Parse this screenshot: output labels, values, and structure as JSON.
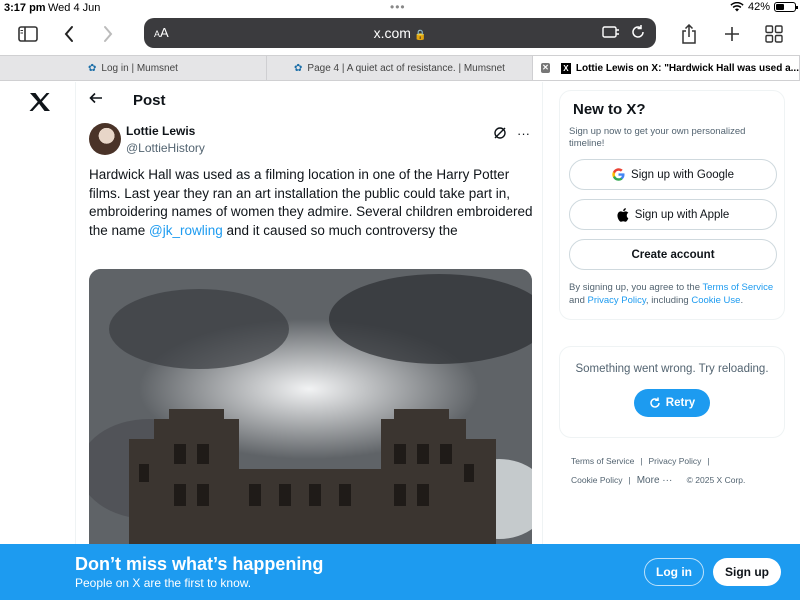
{
  "status": {
    "time": "3:17 pm",
    "date": "Wed 4 Jun",
    "battery": "42%",
    "battery_level": 0.42
  },
  "browser": {
    "text_size": "AA",
    "url": "x.com",
    "tabs": [
      {
        "label": "Log in | Mumsnet"
      },
      {
        "label": "Page 4 | A quiet act of resistance. | Mumsnet"
      },
      {
        "label": "Lottie Lewis on X: \"Hardwick Hall was used a..."
      }
    ]
  },
  "post": {
    "header_title": "Post",
    "author_name": "Lottie Lewis",
    "author_handle": "@LottieHistory",
    "text_before": "Hardwick Hall was used as a filming location in one of the Harry Potter films. Last year they ran an art installation the public could take part in, embroidering names of women they admire. Several children embroidered the name ",
    "mention": "@jk_rowling",
    "text_after": " and it caused so much controversy the"
  },
  "sidebar": {
    "title": "New to X?",
    "subtitle": "Sign up now to get your own personalized timeline!",
    "google_label": "Sign up with Google",
    "apple_label": "Sign up with Apple",
    "create_label": "Create account",
    "terms_prefix": "By signing up, you agree to the ",
    "terms_link": "Terms of Service",
    "terms_and": " and ",
    "privacy_link": "Privacy Policy",
    "terms_mid": ", including ",
    "cookie_link": "Cookie Use",
    "terms_end": ".",
    "error_text": "Something went wrong. Try reloading.",
    "retry_label": "Retry",
    "footer": {
      "terms": "Terms of Service",
      "privacy": "Privacy Policy",
      "cookie": "Cookie Policy",
      "more": "More ···",
      "copyright": "© 2025 X Corp."
    }
  },
  "banner": {
    "headline": "Don’t miss what’s happening",
    "subline": "People on X are the first to know.",
    "login_label": "Log in",
    "signup_label": "Sign up"
  },
  "colors": {
    "accent": "#1d9bf0",
    "text": "#0f1419",
    "muted": "#536471"
  }
}
